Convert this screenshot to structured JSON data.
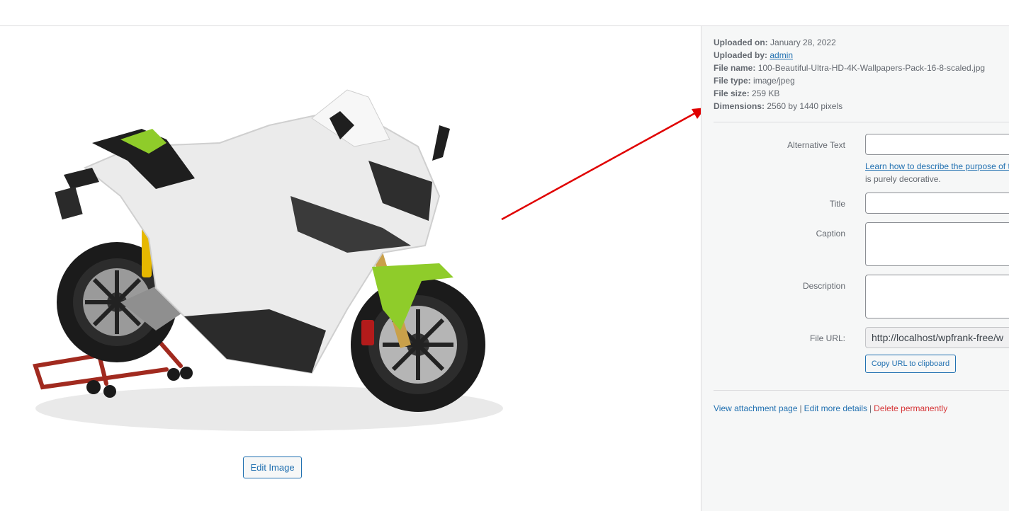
{
  "preview": {
    "edit_image_label": "Edit Image"
  },
  "meta": {
    "uploaded_on_label": "Uploaded on:",
    "uploaded_on_value": "January 28, 2022",
    "uploaded_by_label": "Uploaded by:",
    "uploaded_by_value": "admin",
    "file_name_label": "File name:",
    "file_name_value": "100-Beautiful-Ultra-HD-4K-Wallpapers-Pack-16-8-scaled.jpg",
    "file_type_label": "File type:",
    "file_type_value": "image/jpeg",
    "file_size_label": "File size:",
    "file_size_value": "259 KB",
    "dimensions_label": "Dimensions:",
    "dimensions_value": "2560 by 1440 pixels"
  },
  "form": {
    "alt_text_label": "Alternative Text",
    "alt_help_link": "Learn how to describe the purpose of t",
    "alt_help_text": "is purely decorative.",
    "title_label": "Title",
    "caption_label": "Caption",
    "description_label": "Description",
    "file_url_label": "File URL:",
    "file_url_value": "http://localhost/wpfrank-free/w",
    "copy_url_label": "Copy URL to clipboard"
  },
  "actions": {
    "view_attachment": "View attachment page",
    "edit_details": "Edit more details",
    "delete": "Delete permanently",
    "separator": "|"
  },
  "colors": {
    "link": "#2271b1",
    "danger": "#d63638",
    "annotation_arrow": "#e00000"
  }
}
